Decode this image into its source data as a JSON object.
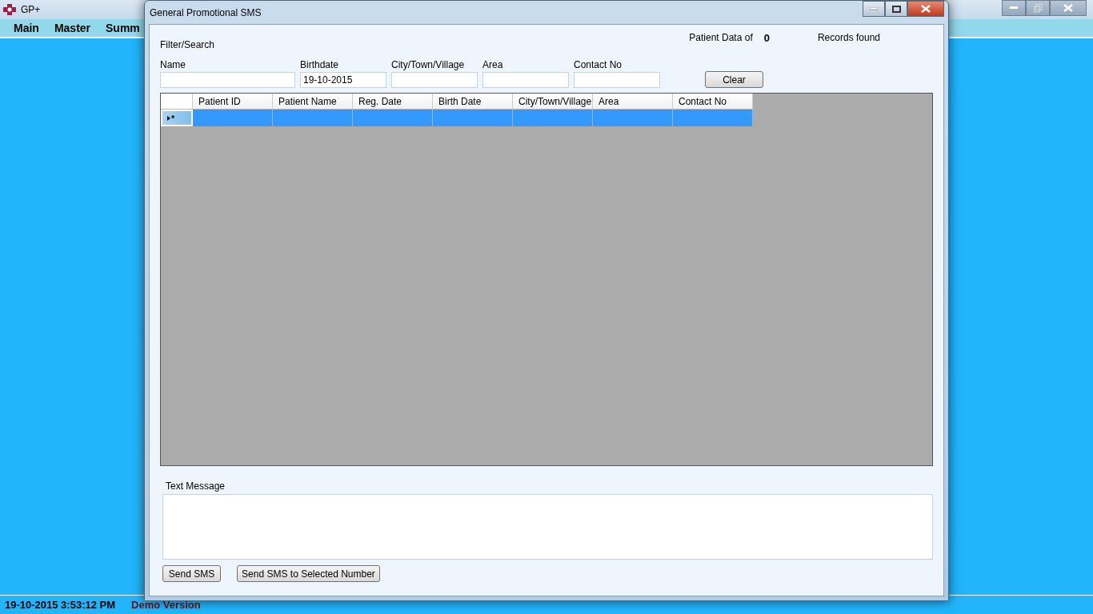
{
  "app": {
    "title": "GP+",
    "menu": [
      "Main",
      "Master",
      "Summ"
    ],
    "status_bar": {
      "datetime": "19-10-2015 3:53:12 PM",
      "edition": "Demo Version"
    }
  },
  "dialog": {
    "title": "General Promotional SMS",
    "filter_label": "Filter/Search",
    "records": {
      "prefix": "Patient Data of",
      "count": "0",
      "suffix": "Records found"
    },
    "fields": [
      {
        "label": "Name"
      },
      {
        "label": "Birthdate",
        "value": "19-10-2015"
      },
      {
        "label": "City/Town/Village"
      },
      {
        "label": "Area"
      },
      {
        "label": "Contact No"
      }
    ],
    "clear_button": "Clear",
    "table": {
      "columns": [
        "Patient ID",
        "Patient Name",
        "Reg. Date",
        "Birth Date",
        "City/Town/Village",
        "Area",
        "Contact No"
      ],
      "rows": [
        {
          "marker": "*",
          "selected": true
        }
      ]
    },
    "message_label": "Text Message",
    "buttons": [
      "Send SMS",
      "Send SMS to Selected Number"
    ]
  }
}
